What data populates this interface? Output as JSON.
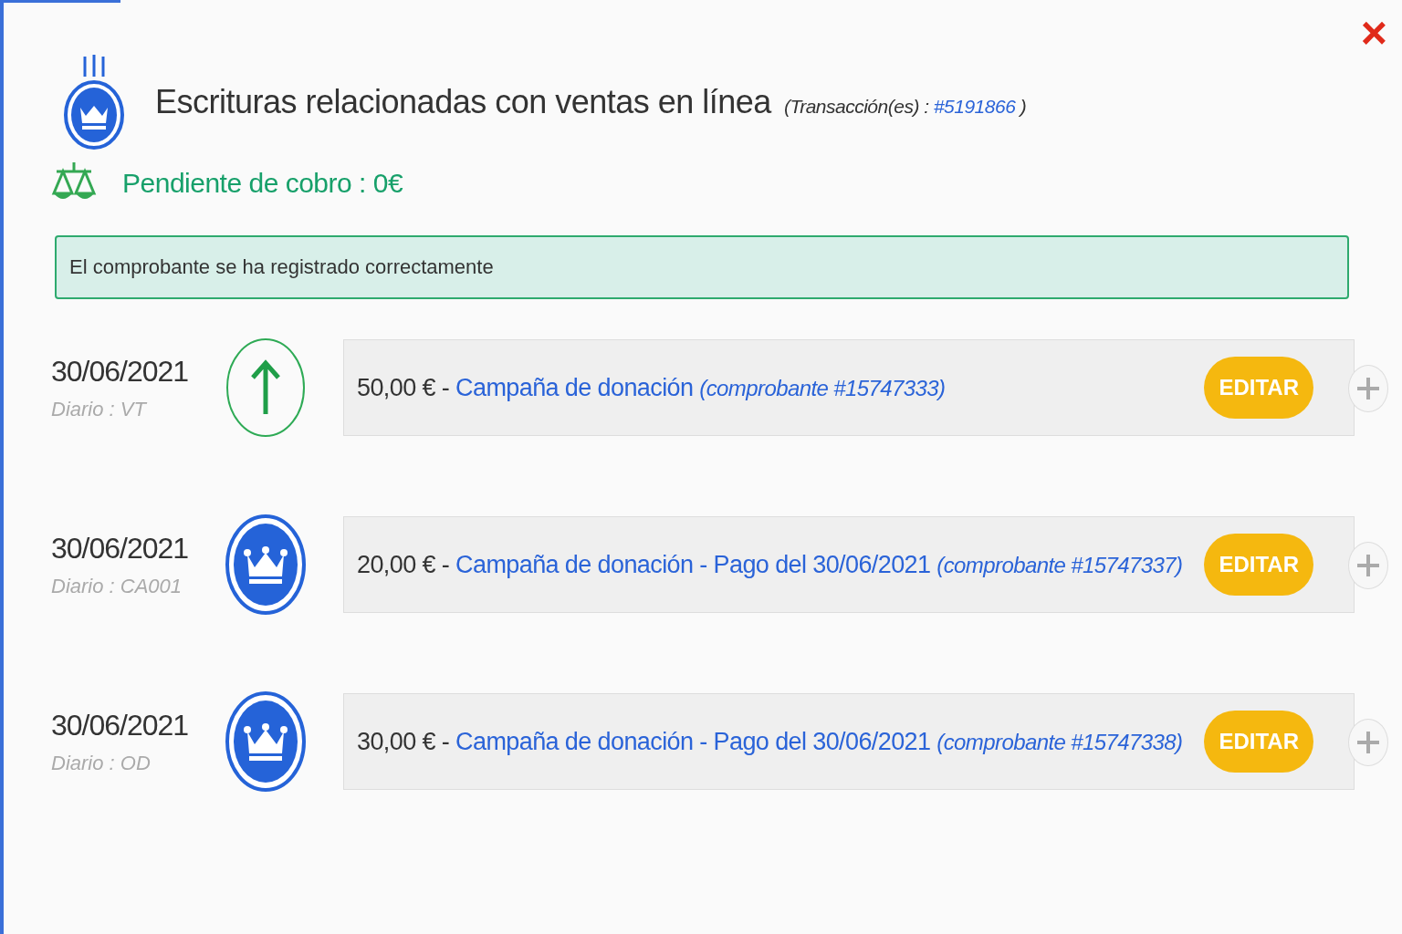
{
  "dialog": {
    "title": "Escrituras relacionadas con ventas en línea",
    "transactions_label": "(Transacción(es) :",
    "transaction_link": "#5191866",
    "transactions_close": ")",
    "close": "×"
  },
  "pending": {
    "text": "Pendiente de cobro : 0€"
  },
  "alert": {
    "text": "El comprobante se ha registrado correctamente"
  },
  "entries": [
    {
      "kind": "sale",
      "date": "30/06/2021",
      "journal": "Diario : VT",
      "amount": "50,00 € -",
      "description": "Campaña de donación",
      "voucher": "(comprobante #15747333)",
      "button": "EDITAR"
    },
    {
      "kind": "payment",
      "date": "30/06/2021",
      "journal": "Diario : CA001",
      "amount": "20,00 € -",
      "description": "Campaña de donación - Pago del 30/06/2021",
      "voucher": "(comprobante #15747337)",
      "button": "EDITAR"
    },
    {
      "kind": "payment",
      "date": "30/06/2021",
      "journal": "Diario : OD",
      "amount": "30,00 € -",
      "description": "Campaña de donación - Pago del 30/06/2021",
      "voucher": "(comprobante #15747338)",
      "button": "EDITAR"
    }
  ]
}
